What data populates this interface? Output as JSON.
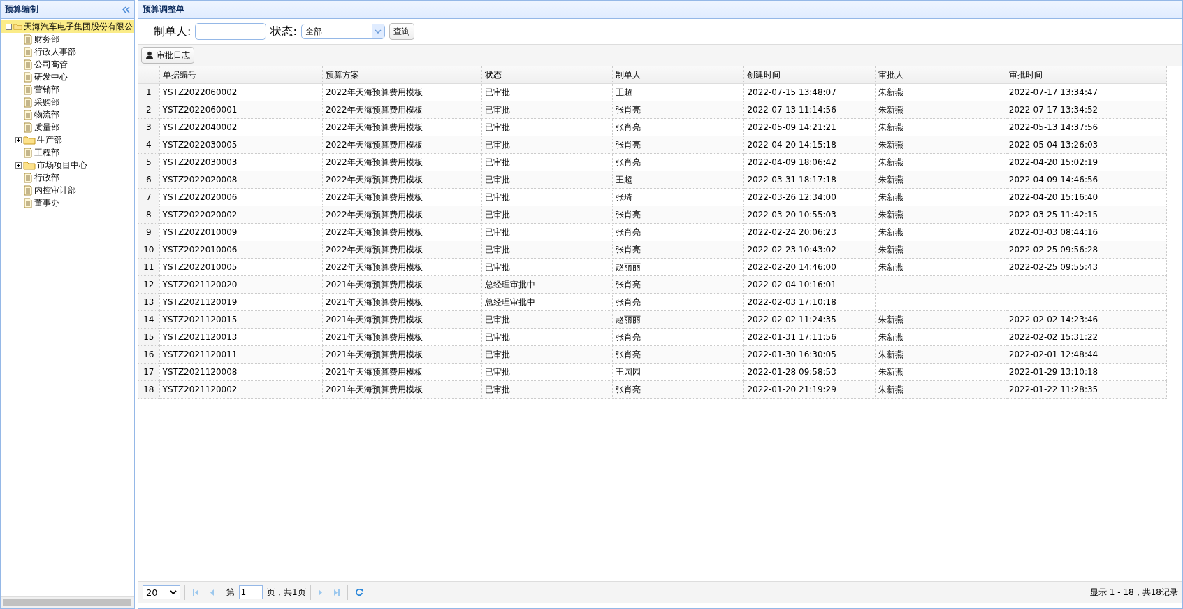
{
  "sidebar": {
    "title": "预算编制",
    "tree": [
      {
        "label": "天海汽车电子集团股份有限公",
        "kind": "folder",
        "expanded": true,
        "selected": true,
        "children": [
          {
            "label": "财务部",
            "kind": "file",
            "selected": false
          },
          {
            "label": "行政人事部",
            "kind": "file",
            "selected": false
          },
          {
            "label": "公司高管",
            "kind": "file",
            "selected": false
          },
          {
            "label": "研发中心",
            "kind": "file",
            "selected": false
          },
          {
            "label": "营销部",
            "kind": "file",
            "selected": false
          },
          {
            "label": "采购部",
            "kind": "file",
            "selected": false
          },
          {
            "label": "物流部",
            "kind": "file",
            "selected": false
          },
          {
            "label": "质量部",
            "kind": "file",
            "selected": false
          },
          {
            "label": "生产部",
            "kind": "folder",
            "expanded": false,
            "selected": false
          },
          {
            "label": "工程部",
            "kind": "file",
            "selected": false
          },
          {
            "label": "市场项目中心",
            "kind": "folder",
            "expanded": false,
            "selected": false
          },
          {
            "label": "行政部",
            "kind": "file",
            "selected": false
          },
          {
            "label": "内控审计部",
            "kind": "file",
            "selected": false
          },
          {
            "label": "董事办",
            "kind": "file",
            "selected": false
          }
        ]
      }
    ]
  },
  "panel": {
    "title": "预算调整单",
    "filters": {
      "maker_label": "制单人:",
      "status_label": "状态:",
      "status_value": "全部",
      "query_button": "查询"
    },
    "toolbar": [
      "审批日志"
    ],
    "table": {
      "columns": [
        "单据编号",
        "预算方案",
        "状态",
        "制单人",
        "创建时间",
        "审批人",
        "审批时间"
      ],
      "rows": [
        {
          "n": "1",
          "cells": [
            "YSTZ2022060002",
            "2022年天海预算费用模板",
            "已审批",
            "王超",
            "2022-07-15 13:48:07",
            "朱新燕",
            "2022-07-17 13:34:47"
          ]
        },
        {
          "n": "2",
          "cells": [
            "YSTZ2022060001",
            "2022年天海预算费用模板",
            "已审批",
            "张肖亮",
            "2022-07-13 11:14:56",
            "朱新燕",
            "2022-07-17 13:34:52"
          ]
        },
        {
          "n": "3",
          "cells": [
            "YSTZ2022040002",
            "2022年天海预算费用模板",
            "已审批",
            "张肖亮",
            "2022-05-09 14:21:21",
            "朱新燕",
            "2022-05-13 14:37:56"
          ]
        },
        {
          "n": "4",
          "cells": [
            "YSTZ2022030005",
            "2022年天海预算费用模板",
            "已审批",
            "张肖亮",
            "2022-04-20 14:15:18",
            "朱新燕",
            "2022-05-04 13:26:03"
          ]
        },
        {
          "n": "5",
          "cells": [
            "YSTZ2022030003",
            "2022年天海预算费用模板",
            "已审批",
            "张肖亮",
            "2022-04-09 18:06:42",
            "朱新燕",
            "2022-04-20 15:02:19"
          ]
        },
        {
          "n": "6",
          "cells": [
            "YSTZ2022020008",
            "2022年天海预算费用模板",
            "已审批",
            "王超",
            "2022-03-31 18:17:18",
            "朱新燕",
            "2022-04-09 14:46:56"
          ]
        },
        {
          "n": "7",
          "cells": [
            "YSTZ2022020006",
            "2022年天海预算费用模板",
            "已审批",
            "张琦",
            "2022-03-26 12:34:00",
            "朱新燕",
            "2022-04-20 15:16:40"
          ]
        },
        {
          "n": "8",
          "cells": [
            "YSTZ2022020002",
            "2022年天海预算费用模板",
            "已审批",
            "张肖亮",
            "2022-03-20 10:55:03",
            "朱新燕",
            "2022-03-25 11:42:15"
          ]
        },
        {
          "n": "9",
          "cells": [
            "YSTZ2022010009",
            "2022年天海预算费用模板",
            "已审批",
            "张肖亮",
            "2022-02-24 20:06:23",
            "朱新燕",
            "2022-03-03 08:44:16"
          ]
        },
        {
          "n": "10",
          "cells": [
            "YSTZ2022010006",
            "2022年天海预算费用模板",
            "已审批",
            "张肖亮",
            "2022-02-23 10:43:02",
            "朱新燕",
            "2022-02-25 09:56:28"
          ]
        },
        {
          "n": "11",
          "cells": [
            "YSTZ2022010005",
            "2022年天海预算费用模板",
            "已审批",
            "赵丽丽",
            "2022-02-20 14:46:00",
            "朱新燕",
            "2022-02-25 09:55:43"
          ]
        },
        {
          "n": "12",
          "cells": [
            "YSTZ2021120020",
            "2021年天海预算费用模板",
            "总经理审批中",
            "张肖亮",
            "2022-02-04 10:16:01"
          ]
        },
        {
          "n": "13",
          "cells": [
            "YSTZ2021120019",
            "2021年天海预算费用模板",
            "总经理审批中",
            "张肖亮",
            "2022-02-03 17:10:18"
          ]
        },
        {
          "n": "14",
          "cells": [
            "YSTZ2021120015",
            "2021年天海预算费用模板",
            "已审批",
            "赵丽丽",
            "2022-02-02 11:24:35",
            "朱新燕",
            "2022-02-02 14:23:46"
          ]
        },
        {
          "n": "15",
          "cells": [
            "YSTZ2021120013",
            "2021年天海预算费用模板",
            "已审批",
            "张肖亮",
            "2022-01-31 17:11:56",
            "朱新燕",
            "2022-02-02 15:31:22"
          ]
        },
        {
          "n": "16",
          "cells": [
            "YSTZ2021120011",
            "2021年天海预算费用模板",
            "已审批",
            "张肖亮",
            "2022-01-30 16:30:05",
            "朱新燕",
            "2022-02-01 12:48:44"
          ]
        },
        {
          "n": "17",
          "cells": [
            "YSTZ2021120008",
            "2021年天海预算费用模板",
            "已审批",
            "王园园",
            "2022-01-28 09:58:53",
            "朱新燕",
            "2022-01-29 13:10:18"
          ]
        },
        {
          "n": "18",
          "cells": [
            "YSTZ2021120002",
            "2021年天海预算费用模板",
            "已审批",
            "张肖亮",
            "2022-01-20 21:19:29",
            "朱新燕",
            "2022-01-22 11:28:35"
          ]
        }
      ]
    },
    "pager": {
      "page_size": "20",
      "page_prefix": "第",
      "page": "1",
      "page_suffix": "页，共1页",
      "summary": "显示 1 - 18，共18记录"
    }
  }
}
